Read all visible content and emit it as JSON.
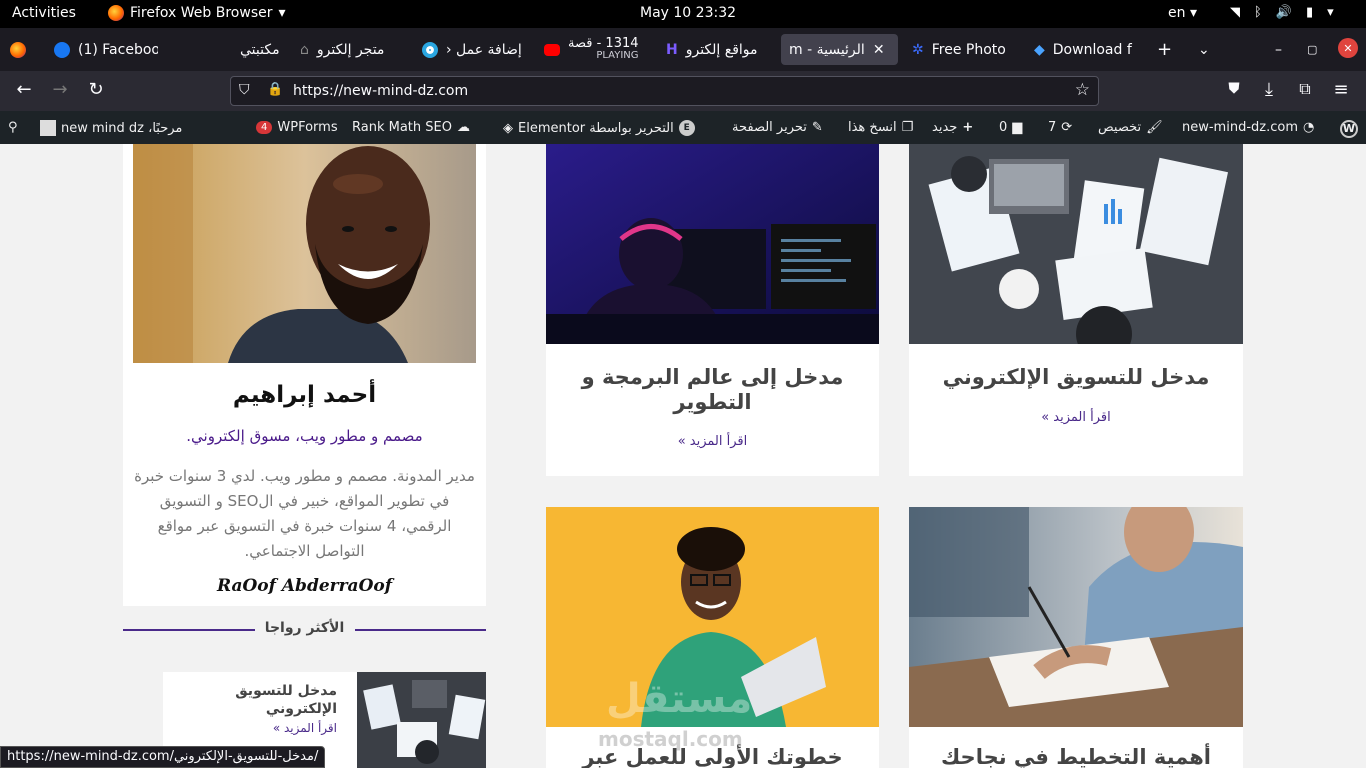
{
  "system": {
    "activities": "Activities",
    "app_name": "Firefox Web Browser",
    "clock": "May 10  23:32",
    "lang": "en"
  },
  "tabs": [
    {
      "label": "(1) Faceboo",
      "icon": "facebook-icon"
    },
    {
      "label": "مكتبتي",
      "icon": ""
    },
    {
      "label": "متجر إلكترو",
      "icon": "store-icon"
    },
    {
      "label": "إضافة عمل ‹",
      "icon": "circle-icon"
    },
    {
      "label": "1314 - قصة",
      "sub": "PLAYING",
      "icon": "youtube-icon"
    },
    {
      "label": "مواقع إلكترو",
      "icon": "h-icon"
    },
    {
      "label": "الرئيسية - m",
      "icon": ""
    },
    {
      "label": "Free Photo",
      "icon": "photo-icon"
    },
    {
      "label": "Download f",
      "icon": "diamond-icon"
    }
  ],
  "nav": {
    "url": "https://new-mind-dz.com"
  },
  "wpbar": {
    "site": "new-mind-dz.com",
    "customize": "تخصيص",
    "updates": "7",
    "comments": "0",
    "new": "جديد",
    "copy": "انسخ هذا",
    "edit": "تحرير الصفحة",
    "elementor": "التحرير بواسطة Elementor",
    "rankmath": "Rank Math SEO",
    "wpforms": "WPForms",
    "wpforms_count": "4",
    "greeting": "مرحبًا، new mind dz"
  },
  "posts": [
    {
      "title": "مدخل للتسويق الإلكتروني",
      "more": "اقرأ المزيد »"
    },
    {
      "title": "مدخل إلى عالم البرمجة و التطوير",
      "more": "اقرأ المزيد »"
    },
    {
      "title": "أهمية التخطيط في نجاحك في"
    },
    {
      "title": "خطوتك الأولى للعمل عبر"
    }
  ],
  "profile": {
    "name": "أحمد إبراهيم",
    "role": "مصمم و مطور ويب، مسوق إلكتروني.",
    "bio": "مدير المدونة. مصمم و مطور ويب. لدي 3 سنوات خبرة في تطوير المواقع، خبير في الSEO و التسويق الرقمي، 4 سنوات خبرة في التسويق عبر مواقع التواصل الاجتماعي.",
    "signature": "RaOof AbderraOof"
  },
  "popular": {
    "heading": "الأكثر رواجا",
    "item_title": "مدخل للتسويق الإلكتروني",
    "item_more": "اقرأ المزيد »"
  },
  "status_url": "https://new-mind-dz.com/مدخل-للتسويق-الإلكتروني/",
  "watermark": "mostaql.com"
}
